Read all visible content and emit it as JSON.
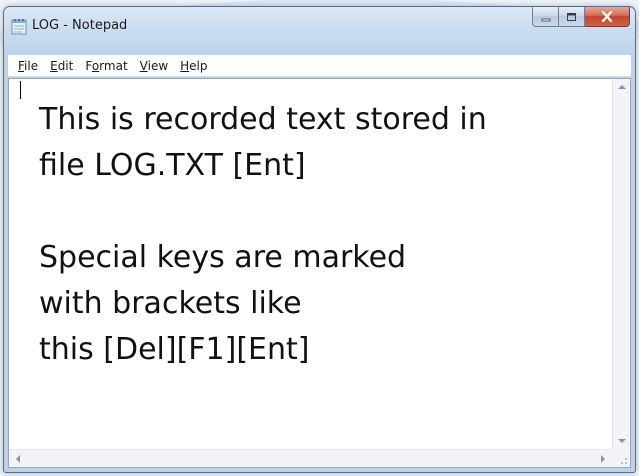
{
  "window": {
    "title": "LOG - Notepad",
    "icon": "notepad-icon"
  },
  "caption_buttons": {
    "minimize_icon": "minimize-icon",
    "maximize_icon": "maximize-icon",
    "close_icon": "close-icon"
  },
  "menu": {
    "items": [
      {
        "label_ul": "F",
        "label_rest": "ile"
      },
      {
        "label_ul": "E",
        "label_rest": "dit"
      },
      {
        "label_pre": "F",
        "label_ul": "o",
        "label_rest": "rmat"
      },
      {
        "label_ul": "V",
        "label_rest": "iew"
      },
      {
        "label_ul": "H",
        "label_rest": "elp"
      }
    ]
  },
  "editor": {
    "lines": [
      "This is recorded text stored in",
      "file LOG.TXT [Ent]",
      "",
      "Special keys are marked",
      "with brackets like",
      "this [Del][F1][Ent]"
    ]
  },
  "colors": {
    "titlebar": "#c9dbef",
    "close_button": "#c4432c",
    "editor_bg": "#ffffff",
    "text": "#111111"
  }
}
